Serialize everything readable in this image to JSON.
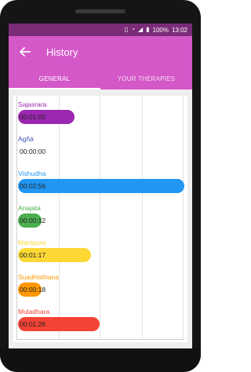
{
  "status_bar": {
    "battery": "100%",
    "time": "13:02"
  },
  "app_bar": {
    "title": "History"
  },
  "tabs": [
    {
      "label": "GENERAL",
      "selected": true
    },
    {
      "label": "YOUR THERAPIES",
      "selected": false
    }
  ],
  "colors": {
    "accent": "#d458c8",
    "status_bar": "#7a2c77"
  },
  "chart_data": {
    "type": "bar",
    "orientation": "horizontal",
    "unit": "hh:mm:ss",
    "grid": true,
    "categories": [
      "Sajasrara",
      "Agñá",
      "Vishudha",
      "Anajata",
      "Manipura",
      "Suadhisthana",
      "Muladhara"
    ],
    "labels": [
      "00:01:00",
      "00:00:00",
      "00:02:56",
      "00:00:12",
      "00:01:17",
      "00:00:18",
      "00:01:26"
    ],
    "values": [
      60,
      0,
      176,
      12,
      77,
      18,
      86
    ],
    "colors": [
      "#9c27b0",
      "#3f51b5",
      "#2196f3",
      "#4caf50",
      "#fdd835",
      "#ff9800",
      "#f44336"
    ]
  }
}
